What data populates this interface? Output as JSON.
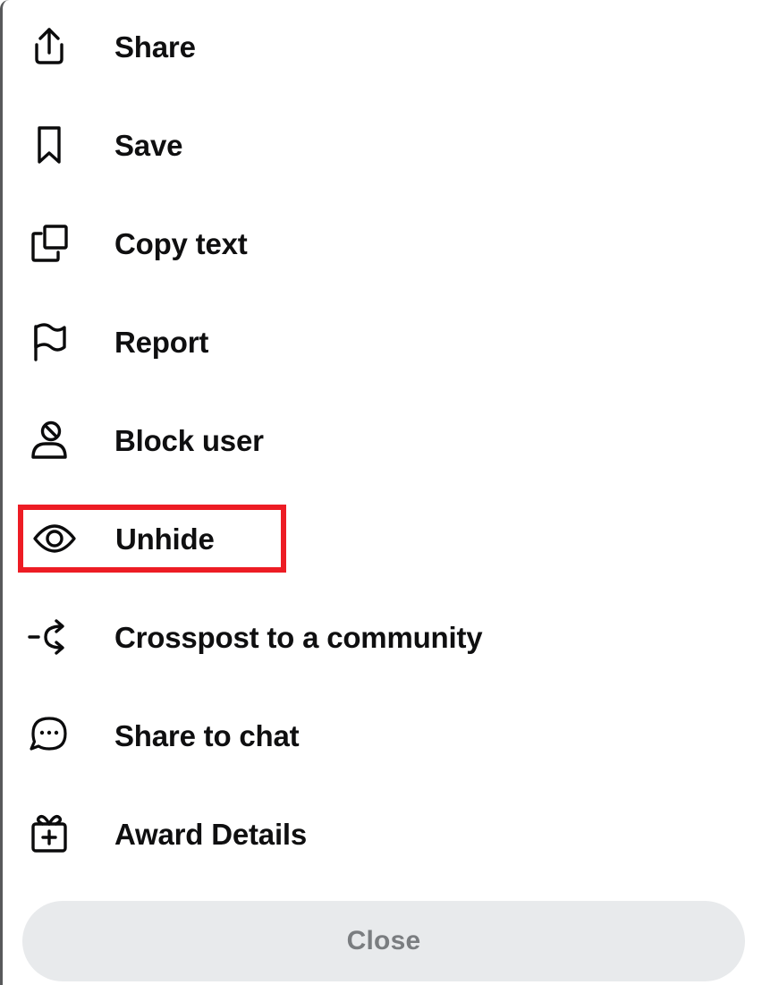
{
  "sheet": {
    "accent_highlight_color": "#ED1C24",
    "text_color": "#0f0f10",
    "background_color": "#ffffff"
  },
  "menu": {
    "items": [
      {
        "label": "Share",
        "icon": "share-icon",
        "highlighted": false
      },
      {
        "label": "Save",
        "icon": "bookmark-icon",
        "highlighted": false
      },
      {
        "label": "Copy text",
        "icon": "copy-icon",
        "highlighted": false
      },
      {
        "label": "Report",
        "icon": "flag-icon",
        "highlighted": false
      },
      {
        "label": "Block user",
        "icon": "block-user-icon",
        "highlighted": false
      },
      {
        "label": "Unhide",
        "icon": "eye-icon",
        "highlighted": true
      },
      {
        "label": "Crosspost to a community",
        "icon": "crosspost-icon",
        "highlighted": false
      },
      {
        "label": "Share to chat",
        "icon": "chat-bubble-icon",
        "highlighted": false
      },
      {
        "label": "Award Details",
        "icon": "gift-icon",
        "highlighted": false
      }
    ]
  },
  "footer": {
    "close_label": "Close",
    "close_background_color": "#E8EAEC",
    "close_text_color": "#7a7d80"
  }
}
